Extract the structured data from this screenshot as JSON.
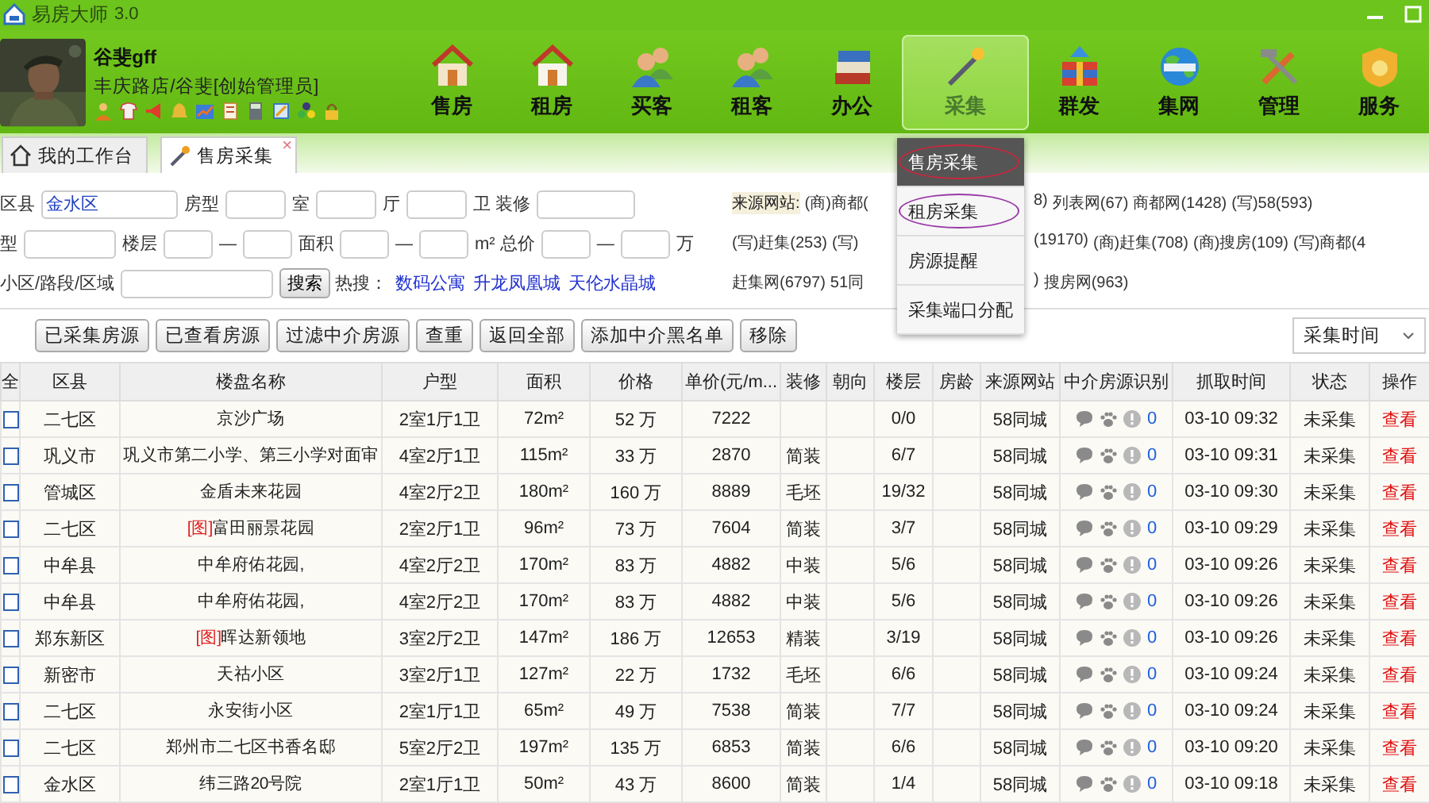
{
  "window": {
    "title": "易房大师",
    "version": "3.0"
  },
  "user": {
    "name": "谷斐gff",
    "role": "丰庆路店/谷斐[创始管理员]"
  },
  "nav": [
    {
      "label": "售房",
      "selected": false
    },
    {
      "label": "租房",
      "selected": false
    },
    {
      "label": "买客",
      "selected": false
    },
    {
      "label": "租客",
      "selected": false
    },
    {
      "label": "办公",
      "selected": false
    },
    {
      "label": "采集",
      "selected": true
    },
    {
      "label": "群发",
      "selected": false
    },
    {
      "label": "集网",
      "selected": false
    },
    {
      "label": "管理",
      "selected": false
    },
    {
      "label": "服务",
      "selected": false
    }
  ],
  "tabs": [
    {
      "label": "我的工作台",
      "selected": false
    },
    {
      "label": "售房采集",
      "selected": true,
      "close": "×"
    }
  ],
  "search_form": {
    "rows": [
      {
        "items": [
          {
            "kind": "label",
            "text": "区县"
          },
          {
            "kind": "field",
            "value": "金水区"
          },
          {
            "kind": "label",
            "text": "房型"
          },
          {
            "kind": "field"
          },
          {
            "kind": "label",
            "text": "室"
          },
          {
            "kind": "field"
          },
          {
            "kind": "label",
            "text": "厅"
          },
          {
            "kind": "field"
          },
          {
            "kind": "label",
            "text": "卫"
          },
          {
            "kind": "label",
            "text": "装修"
          },
          {
            "kind": "field"
          }
        ]
      },
      {
        "items": [
          {
            "kind": "label",
            "text": "型"
          },
          {
            "kind": "field"
          },
          {
            "kind": "label",
            "text": "楼层"
          },
          {
            "kind": "field"
          },
          {
            "kind": "label",
            "text": "—"
          },
          {
            "kind": "field"
          },
          {
            "kind": "label",
            "text": "面积"
          },
          {
            "kind": "field"
          },
          {
            "kind": "label",
            "text": "—"
          },
          {
            "kind": "field"
          },
          {
            "kind": "label",
            "text": "m²"
          },
          {
            "kind": "label",
            "text": "总价"
          },
          {
            "kind": "field"
          },
          {
            "kind": "label",
            "text": "—"
          },
          {
            "kind": "field"
          },
          {
            "kind": "label",
            "text": "万"
          }
        ]
      },
      {
        "items": [
          {
            "kind": "label",
            "text": "小区/路段/区域"
          },
          {
            "kind": "field"
          },
          {
            "kind": "button",
            "text": "搜索"
          },
          {
            "kind": "label",
            "text": "热搜："
          },
          {
            "kind": "link",
            "text": "数码公寓"
          },
          {
            "kind": "link",
            "text": "升龙凤凰城"
          },
          {
            "kind": "link",
            "text": "天伦水晶城"
          }
        ]
      }
    ]
  },
  "source_sites": {
    "label": "来源网站:",
    "rows": [
      {
        "left": [
          "(商)商都("
        ],
        "right": [
          "8)",
          "列表网(67)",
          "商都网(1428)",
          "(写)58(593)"
        ]
      },
      {
        "left": [
          "(写)赶集(253)",
          "(写)"
        ],
        "right": [
          "(19170)",
          "(商)赶集(708)",
          "(商)搜房(109)",
          "(写)商都(4"
        ]
      },
      {
        "left": [
          "赶集网(6797)",
          "51同"
        ],
        "right": [
          ")",
          "搜房网(963)"
        ]
      }
    ]
  },
  "dropdown_menu": {
    "items": [
      {
        "label": "售房采集",
        "highlighted": true,
        "color": "#c8283c"
      },
      {
        "label": "租房采集",
        "highlighted": false,
        "color": "#9a3aa8"
      },
      {
        "label": "房源提醒",
        "highlighted": false
      },
      {
        "label": "采集端口分配",
        "highlighted": false
      }
    ]
  },
  "actions": [
    "已采集房源",
    "已查看房源",
    "过滤中介房源",
    "查重",
    "返回全部",
    "添加中介黑名单",
    "移除"
  ],
  "sort": {
    "value": "采集时间"
  },
  "table": {
    "columns": [
      "全",
      "区县",
      "楼盘名称",
      "户型",
      "面积",
      "价格",
      "单价(元/m...",
      "装修",
      "朝向",
      "楼层",
      "房龄",
      "来源网站",
      "中介房源识别",
      "抓取时间",
      "状态",
      "操作"
    ],
    "rows": [
      {
        "checked": false,
        "district": "二七区",
        "name": "京沙广场",
        "layout": "2室1厅1卫",
        "area": "72m²",
        "price": "52 万",
        "unit_price": "7222",
        "decoration": "",
        "floor": "0/0",
        "source": "58同城",
        "agent_count": "0",
        "time": "03-10 09:32",
        "status": "未采集",
        "action": "查看"
      },
      {
        "checked": false,
        "district": "巩义市",
        "name": "巩义市第二小学、第三小学对面审",
        "layout": "4室2厅1卫",
        "area": "115m²",
        "price": "33 万",
        "unit_price": "2870",
        "decoration": "简装",
        "floor": "6/7",
        "source": "58同城",
        "agent_count": "0",
        "time": "03-10 09:31",
        "status": "未采集",
        "action": "查看"
      },
      {
        "checked": false,
        "district": "管城区",
        "name": "金盾未来花园",
        "layout": "4室2厅2卫",
        "area": "180m²",
        "price": "160 万",
        "unit_price": "8889",
        "decoration": "毛坯",
        "floor": "19/32",
        "source": "58同城",
        "agent_count": "0",
        "time": "03-10 09:30",
        "status": "未采集",
        "action": "查看"
      },
      {
        "checked": false,
        "district": "二七区",
        "tag": "[图]",
        "name": "富田丽景花园",
        "layout": "2室2厅1卫",
        "area": "96m²",
        "price": "73 万",
        "unit_price": "7604",
        "decoration": "简装",
        "floor": "3/7",
        "source": "58同城",
        "agent_count": "0",
        "time": "03-10 09:29",
        "status": "未采集",
        "action": "查看"
      },
      {
        "checked": false,
        "district": "中牟县",
        "name": "中牟府佑花园,",
        "layout": "4室2厅2卫",
        "area": "170m²",
        "price": "83 万",
        "unit_price": "4882",
        "decoration": "中装",
        "floor": "5/6",
        "source": "58同城",
        "agent_count": "0",
        "time": "03-10 09:26",
        "status": "未采集",
        "action": "查看"
      },
      {
        "checked": false,
        "district": "中牟县",
        "name": "中牟府佑花园,",
        "layout": "4室2厅2卫",
        "area": "170m²",
        "price": "83 万",
        "unit_price": "4882",
        "decoration": "中装",
        "floor": "5/6",
        "source": "58同城",
        "agent_count": "0",
        "time": "03-10 09:26",
        "status": "未采集",
        "action": "查看"
      },
      {
        "checked": false,
        "district": "郑东新区",
        "tag": "[图]",
        "name": "晖达新领地",
        "layout": "3室2厅2卫",
        "area": "147m²",
        "price": "186 万",
        "unit_price": "12653",
        "decoration": "精装",
        "floor": "3/19",
        "source": "58同城",
        "agent_count": "0",
        "time": "03-10 09:26",
        "status": "未采集",
        "action": "查看"
      },
      {
        "checked": false,
        "district": "新密市",
        "name": "天祜小区",
        "layout": "3室2厅1卫",
        "area": "127m²",
        "price": "22 万",
        "unit_price": "1732",
        "decoration": "毛坯",
        "floor": "6/6",
        "source": "58同城",
        "agent_count": "0",
        "time": "03-10 09:24",
        "status": "未采集",
        "action": "查看"
      },
      {
        "checked": false,
        "district": "二七区",
        "name": "永安街小区",
        "layout": "2室1厅1卫",
        "area": "65m²",
        "price": "49 万",
        "unit_price": "7538",
        "decoration": "简装",
        "floor": "7/7",
        "source": "58同城",
        "agent_count": "0",
        "time": "03-10 09:24",
        "status": "未采集",
        "action": "查看"
      },
      {
        "checked": false,
        "district": "二七区",
        "name": "郑州市二七区书香名邸",
        "layout": "5室2厅2卫",
        "area": "197m²",
        "price": "135 万",
        "unit_price": "6853",
        "decoration": "简装",
        "floor": "6/6",
        "source": "58同城",
        "agent_count": "0",
        "time": "03-10 09:20",
        "status": "未采集",
        "action": "查看"
      },
      {
        "checked": false,
        "district": "金水区",
        "name": "纬三路20号院",
        "layout": "2室1厅1卫",
        "area": "50m²",
        "price": "43 万",
        "unit_price": "8600",
        "decoration": "简装",
        "floor": "1/4",
        "source": "58同城",
        "agent_count": "0",
        "time": "03-10 09:18",
        "status": "未采集",
        "action": "查看"
      }
    ]
  }
}
